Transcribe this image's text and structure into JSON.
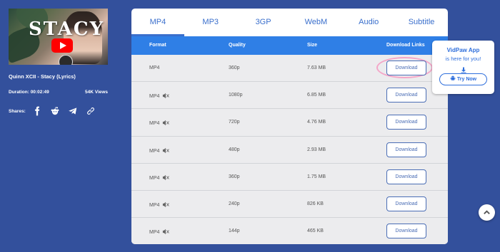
{
  "video": {
    "thumbnail_text": "STACY",
    "title": "Quinn XCII - Stacy (Lyrics)",
    "duration": "Duration: 00:02:49",
    "views": "54K Views",
    "shares_label": "Shares:",
    "share_icons": [
      "facebook-icon",
      "reddit-icon",
      "telegram-icon",
      "link-icon"
    ]
  },
  "tabs": [
    "MP4",
    "MP3",
    "3GP",
    "WebM",
    "Audio",
    "Subtitle"
  ],
  "active_tab": "MP4",
  "table": {
    "headers": {
      "format": "Format",
      "quality": "Quality",
      "size": "Size",
      "links": "Download Links"
    },
    "rows": [
      {
        "format": "MP4",
        "muted": false,
        "quality": "360p",
        "size": "7.63 MB",
        "button": "Download"
      },
      {
        "format": "MP4",
        "muted": true,
        "quality": "1080p",
        "size": "6.85 MB",
        "button": "Download"
      },
      {
        "format": "MP4",
        "muted": true,
        "quality": "720p",
        "size": "4.76 MB",
        "button": "Download"
      },
      {
        "format": "MP4",
        "muted": true,
        "quality": "480p",
        "size": "2.93 MB",
        "button": "Download"
      },
      {
        "format": "MP4",
        "muted": true,
        "quality": "360p",
        "size": "1.75 MB",
        "button": "Download"
      },
      {
        "format": "MP4",
        "muted": true,
        "quality": "240p",
        "size": "826 KB",
        "button": "Download"
      },
      {
        "format": "MP4",
        "muted": true,
        "quality": "144p",
        "size": "465 KB",
        "button": "Download"
      }
    ]
  },
  "promo": {
    "title": "VidPaw App",
    "subtitle": "is here for you!",
    "button": "Try Now"
  },
  "colors": {
    "background": "#33509c",
    "accent": "#2f7fe6",
    "tab_text": "#3a6fcc",
    "highlight": "#f4a6c8"
  }
}
